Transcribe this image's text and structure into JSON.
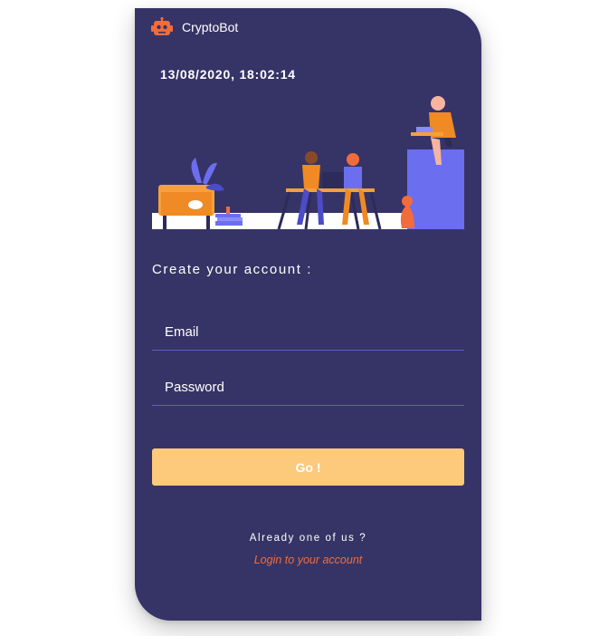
{
  "app": {
    "name": "CryptoBot",
    "logo_icon": "robot-icon",
    "accent_color": "#f26c3b"
  },
  "datetime": "13/08/2020, 18:02:14",
  "illustration": {
    "icon": "team-working-illustration"
  },
  "form": {
    "heading": "Create your account :",
    "email_placeholder": "Email",
    "password_placeholder": "Password",
    "submit_label": "Go !",
    "submit_color": "#fdc97b"
  },
  "footer": {
    "already_text": "Already one of us ?",
    "login_link": "Login to your account"
  },
  "colors": {
    "card_background": "#363466",
    "field_underline": "#5b5fc0"
  }
}
